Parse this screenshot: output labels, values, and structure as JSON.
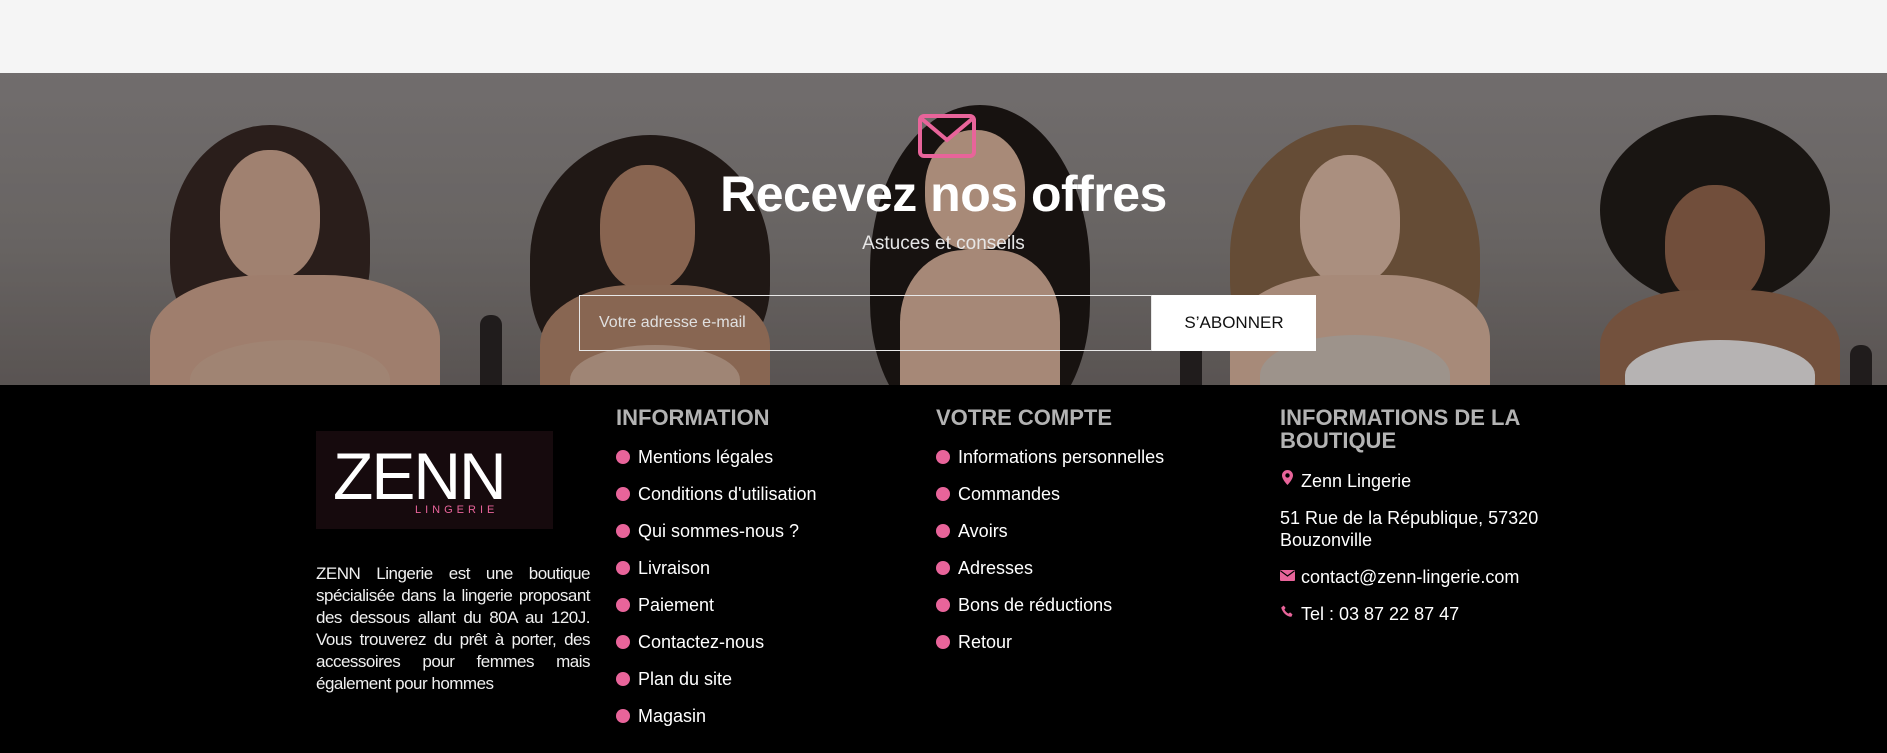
{
  "newsletter": {
    "title": "Recevez nos offres",
    "subtitle": "Astuces et conseils",
    "email_placeholder": "Votre adresse e-mail",
    "subscribe_label": "S’ABONNER",
    "icon": "envelope-icon",
    "accent_color": "#e8649a"
  },
  "brand": {
    "logo_main": "ZENN",
    "logo_sub": "LINGERIE",
    "about": "ZENN Lingerie est une boutique spécialisée dans la lingerie proposant des dessous allant du 80A au 120J. Vous trouverez du prêt à porter, des accessoires pour femmes mais également pour hommes"
  },
  "information": {
    "title": "INFORMATION",
    "items": [
      "Mentions légales",
      "Conditions d'utilisation",
      "Qui sommes-nous ?",
      "Livraison",
      "Paiement",
      "Contactez-nous",
      "Plan du site",
      "Magasin"
    ]
  },
  "account": {
    "title": "VOTRE COMPTE",
    "items": [
      "Informations personnelles",
      "Commandes",
      "Avoirs",
      "Adresses",
      "Bons de réductions",
      "Retour"
    ]
  },
  "shop": {
    "title": "INFORMATIONS DE LA BOUTIQUE",
    "name": "Zenn Lingerie",
    "address": "51 Rue de la République, 57320 Bouzonville",
    "email": "contact@zenn-lingerie.com",
    "phone": "Tel : 03 87 22 87 47",
    "icons": [
      "map-pin-icon",
      "envelope-icon",
      "phone-icon"
    ]
  }
}
